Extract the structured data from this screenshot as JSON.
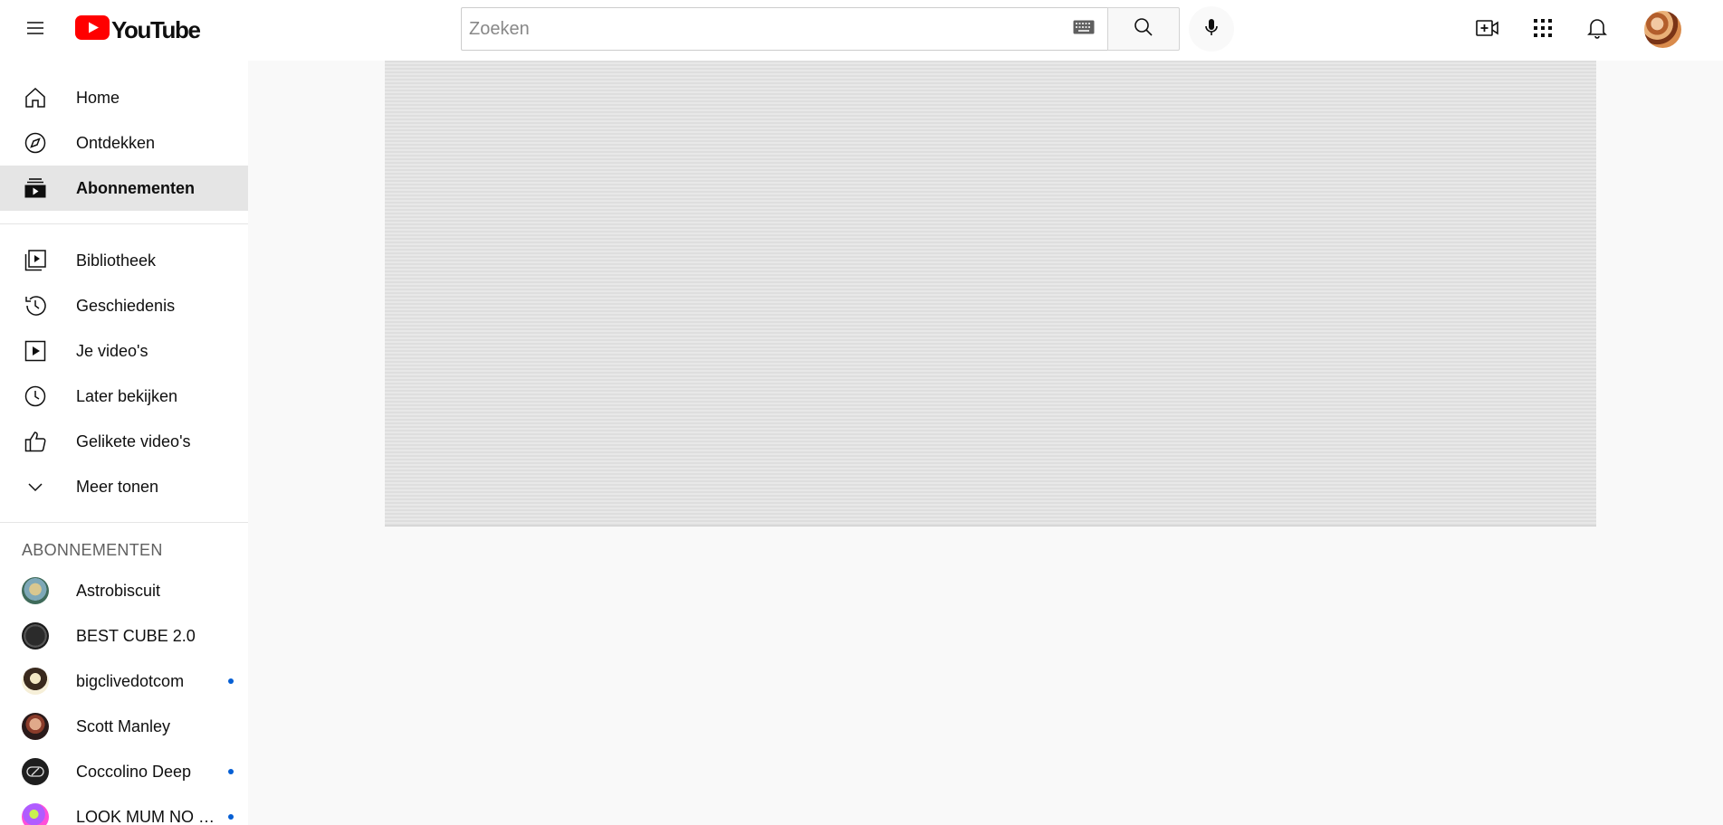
{
  "header": {
    "logo_text": "YouTube",
    "search": {
      "placeholder": "Zoeken",
      "value": ""
    },
    "icons": {
      "menu": "hamburger-menu-icon",
      "keyboard": "keyboard-icon",
      "search": "search-icon",
      "mic": "microphone-icon",
      "create": "create-video-icon",
      "apps": "apps-grid-icon",
      "notifications": "bell-icon"
    },
    "brand_color": "#ff0000"
  },
  "sidebar": {
    "primary": [
      {
        "label": "Home",
        "icon": "home-icon"
      },
      {
        "label": "Ontdekken",
        "icon": "compass-icon"
      },
      {
        "label": "Abonnementen",
        "icon": "subscriptions-icon",
        "active": true
      }
    ],
    "library": [
      {
        "label": "Bibliotheek",
        "icon": "library-icon"
      },
      {
        "label": "Geschiedenis",
        "icon": "history-icon"
      },
      {
        "label": "Je video's",
        "icon": "your-videos-icon"
      },
      {
        "label": "Later bekijken",
        "icon": "watch-later-icon"
      },
      {
        "label": "Gelikete video's",
        "icon": "liked-videos-icon"
      },
      {
        "label": "Meer tonen",
        "icon": "chevron-down-icon"
      }
    ],
    "subscriptions_title": "ABONNEMENTEN",
    "subscriptions": [
      {
        "label": "Astrobiscuit",
        "new": false
      },
      {
        "label": "BEST CUBE 2.0",
        "new": false
      },
      {
        "label": "bigclivedotcom",
        "new": true
      },
      {
        "label": "Scott Manley",
        "new": false
      },
      {
        "label": "Coccolino Deep",
        "new": true
      },
      {
        "label": "LOOK MUM NO COMPUTER",
        "new": true
      }
    ],
    "new_content_dot_color": "#065fd4"
  }
}
